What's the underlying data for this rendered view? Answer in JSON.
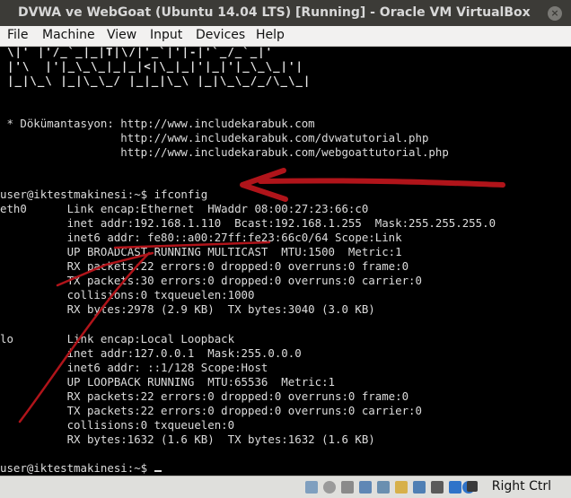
{
  "window": {
    "title": "DVWA ve WebGoat (Ubuntu 14.04 LTS) [Running] - Oracle VM VirtualBox",
    "close_glyph": "×"
  },
  "menu": [
    "File",
    "Machine",
    "View",
    "Input",
    "Devices",
    "Help"
  ],
  "terminal": {
    "banner": [
      "\\|' |'/_`_|_|T|\\/|'_`|'|-|'`_/_`_|'",
      "|'\\  |'|_\\_\\_|_|_|<|\\_|_|'|_|'|_\\_\\_|'|",
      "|_|\\_\\ |_|\\_\\_/ |_|_|\\_\\ |_|\\_\\_/_/\\_\\_|"
    ],
    "lines": [
      " * Dökümantasyon: http://www.includekarabuk.com",
      "                  http://www.includekarabuk.com/dvwatutorial.php",
      "                  http://www.includekarabuk.com/webgoattutorial.php",
      "",
      "user@iktestmakinesi:~$ ifconfig",
      "eth0      Link encap:Ethernet  HWaddr 08:00:27:23:66:c0",
      "          inet addr:192.168.1.110  Bcast:192.168.1.255  Mask:255.255.255.0",
      "          inet6 addr: fe80::a00:27ff:fe23:66c0/64 Scope:Link",
      "          UP BROADCAST RUNNING MULTICAST  MTU:1500  Metric:1",
      "          RX packets:22 errors:0 dropped:0 overruns:0 frame:0",
      "          TX packets:30 errors:0 dropped:0 overruns:0 carrier:0",
      "          collisions:0 txqueuelen:1000",
      "          RX bytes:2978 (2.9 KB)  TX bytes:3040 (3.0 KB)",
      "",
      "lo        Link encap:Local Loopback",
      "          inet addr:127.0.0.1  Mask:255.0.0.0",
      "          inet6 addr: ::1/128 Scope:Host",
      "          UP LOOPBACK RUNNING  MTU:65536  Metric:1",
      "          RX packets:22 errors:0 dropped:0 overruns:0 frame:0",
      "          TX packets:22 errors:0 dropped:0 overruns:0 carrier:0",
      "          collisions:0 txqueuelen:0",
      "          RX bytes:1632 (1.6 KB)  TX bytes:1632 (1.6 KB)",
      "",
      "user@iktestmakinesi:~$ "
    ]
  },
  "annotation": {
    "color": "#b0141a"
  },
  "statusbar": {
    "host_key": "Right Ctrl",
    "icons": [
      "hard-disk-icon",
      "optical-disk-icon",
      "audio-icon",
      "network-icon",
      "usb-icon",
      "shared-folders-icon",
      "display-icon",
      "video-capture-icon",
      "cpu-icon",
      "mouse-integration-icon"
    ]
  }
}
